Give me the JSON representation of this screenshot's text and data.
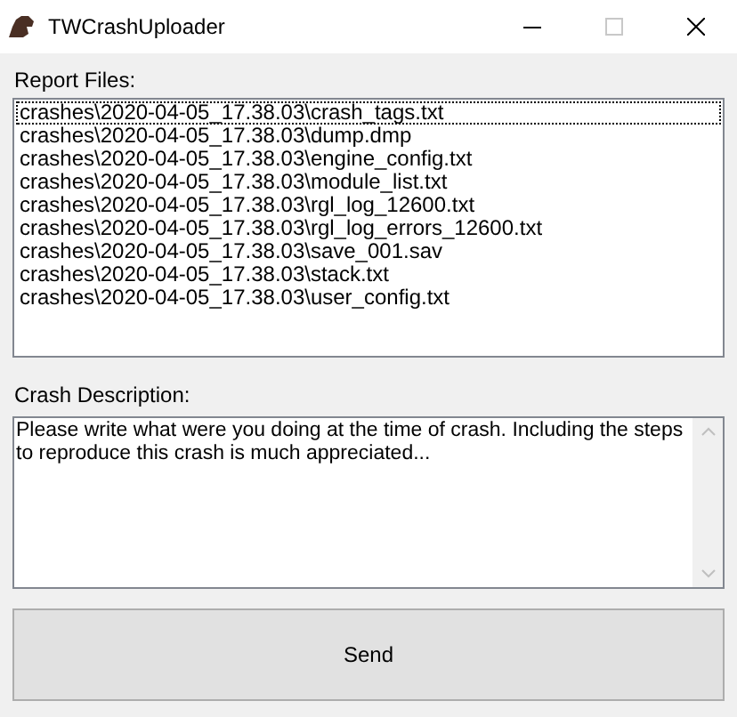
{
  "window": {
    "title": "TWCrashUploader"
  },
  "report_files": {
    "label": "Report Files:",
    "items": [
      {
        "text": "crashes\\2020-04-05_17.38.03\\crash_tags.txt",
        "focused": true
      },
      {
        "text": "crashes\\2020-04-05_17.38.03\\dump.dmp",
        "focused": false
      },
      {
        "text": "crashes\\2020-04-05_17.38.03\\engine_config.txt",
        "focused": false
      },
      {
        "text": "crashes\\2020-04-05_17.38.03\\module_list.txt",
        "focused": false
      },
      {
        "text": "crashes\\2020-04-05_17.38.03\\rgl_log_12600.txt",
        "focused": false
      },
      {
        "text": "crashes\\2020-04-05_17.38.03\\rgl_log_errors_12600.txt",
        "focused": false
      },
      {
        "text": "crashes\\2020-04-05_17.38.03\\save_001.sav",
        "focused": false
      },
      {
        "text": "crashes\\2020-04-05_17.38.03\\stack.txt",
        "focused": false
      },
      {
        "text": "crashes\\2020-04-05_17.38.03\\user_config.txt",
        "focused": false
      }
    ]
  },
  "crash_description": {
    "label": "Crash Description:",
    "value": "Please write what were you doing at the time of crash. Including the steps to reproduce this crash is much appreciated..."
  },
  "send_button": {
    "label": "Send"
  }
}
